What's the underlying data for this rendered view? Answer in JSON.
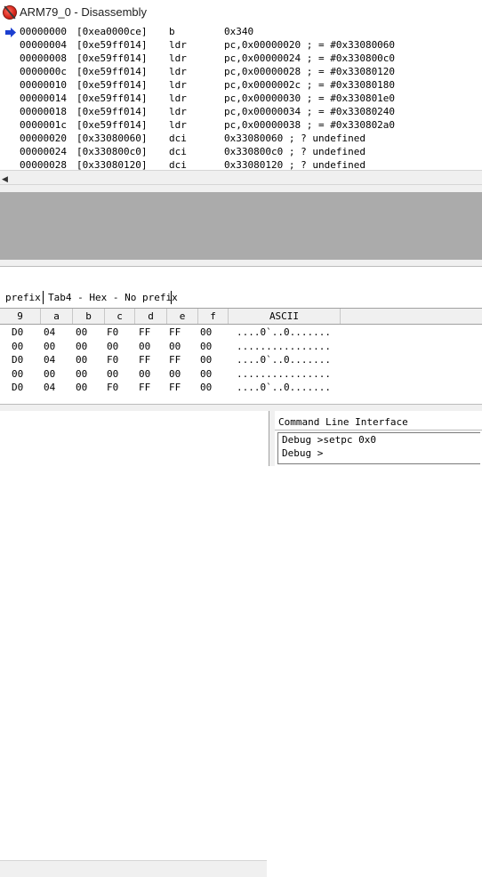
{
  "window": {
    "title": "ARM79_0 - Disassembly"
  },
  "disassembly": {
    "rows": [
      {
        "addr": "00000000",
        "code": "[0xea0000ce]",
        "mnem": "b",
        "ops": "0x340",
        "current": true
      },
      {
        "addr": "00000004",
        "code": "[0xe59ff014]",
        "mnem": "ldr",
        "ops": "pc,0x00000020 ; = #0x33080060"
      },
      {
        "addr": "00000008",
        "code": "[0xe59ff014]",
        "mnem": "ldr",
        "ops": "pc,0x00000024 ; = #0x330800c0"
      },
      {
        "addr": "0000000c",
        "code": "[0xe59ff014]",
        "mnem": "ldr",
        "ops": "pc,0x00000028 ; = #0x33080120"
      },
      {
        "addr": "00000010",
        "code": "[0xe59ff014]",
        "mnem": "ldr",
        "ops": "pc,0x0000002c ; = #0x33080180"
      },
      {
        "addr": "00000014",
        "code": "[0xe59ff014]",
        "mnem": "ldr",
        "ops": "pc,0x00000030 ; = #0x330801e0"
      },
      {
        "addr": "00000018",
        "code": "[0xe59ff014]",
        "mnem": "ldr",
        "ops": "pc,0x00000034 ; = #0x33080240"
      },
      {
        "addr": "0000001c",
        "code": "[0xe59ff014]",
        "mnem": "ldr",
        "ops": "pc,0x00000038 ; = #0x330802a0"
      },
      {
        "addr": "00000020",
        "code": "[0x33080060]",
        "mnem": "dci",
        "ops": "0x33080060 ; ? undefined"
      },
      {
        "addr": "00000024",
        "code": "[0x330800c0]",
        "mnem": "dci",
        "ops": "0x330800c0 ; ? undefined"
      },
      {
        "addr": "00000028",
        "code": "[0x33080120]",
        "mnem": "dci",
        "ops": "0x33080120 ; ? undefined"
      }
    ]
  },
  "memory": {
    "tabs": [
      {
        "label": "prefix"
      },
      {
        "label": "Tab4 - Hex - No prefix"
      }
    ],
    "columns": [
      "9",
      "a",
      "b",
      "c",
      "d",
      "e",
      "f",
      "ASCII"
    ],
    "rows": [
      {
        "cells": [
          "D0",
          "04",
          "00",
          "F0",
          "FF",
          "FF",
          "00"
        ],
        "ascii": "....0`..0......."
      },
      {
        "cells": [
          "00",
          "00",
          "00",
          "00",
          "00",
          "00",
          "00"
        ],
        "ascii": "................"
      },
      {
        "cells": [
          "D0",
          "04",
          "00",
          "F0",
          "FF",
          "FF",
          "00"
        ],
        "ascii": "....0`..0......."
      },
      {
        "cells": [
          "00",
          "00",
          "00",
          "00",
          "00",
          "00",
          "00"
        ],
        "ascii": "................"
      },
      {
        "cells": [
          "D0",
          "04",
          "00",
          "F0",
          "FF",
          "FF",
          "00"
        ],
        "ascii": "....0`..0......."
      }
    ]
  },
  "cli": {
    "title": "Command Line Interface",
    "lines": [
      "Debug >setpc 0x0",
      "Debug >"
    ]
  },
  "icons": {
    "app": "arm-debugger-icon",
    "pc_marker": "current-pc-arrow-icon",
    "scroll_left": "scroll-left-arrow-icon"
  },
  "colors": {
    "pc_arrow": "#1c3fd0",
    "empty_pane": "#ababab"
  }
}
